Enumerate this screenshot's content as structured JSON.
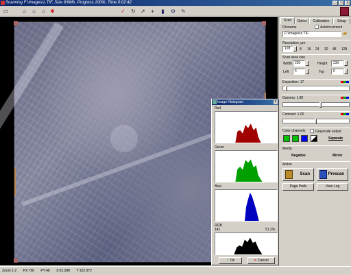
{
  "window": {
    "title": "Scanning F:\\Images\\z.TIF, Size 9/9Mb, Progress 100%, Time 0:02:42",
    "minimize": "_",
    "maximize": "□",
    "close": "x"
  },
  "toolbar": {
    "icons": [
      "open-icon",
      "home-icon",
      "prev-home-icon",
      "next-home-icon",
      "figure-icon",
      "check-icon",
      "rotate-icon",
      "pointer-icon",
      "crosshair-icon",
      "chart-icon",
      "gears-icon",
      "camera-icon",
      "book-icon"
    ],
    "glyphs": [
      "▭",
      "⌂",
      "⌂",
      "⌂",
      "✱",
      "✓",
      "↻",
      "➚",
      "+",
      "▮",
      "⚙",
      "✎"
    ]
  },
  "panel": {
    "tabs": [
      "Scan",
      "Optics",
      "Calibration",
      "Setup"
    ],
    "filename_label": "Filename",
    "autoincrement_label": "Autoincrement",
    "filename_value": "F:\\Images\\z.TIF",
    "resolution_label": "Resolution, µm",
    "resolution_value": "128",
    "resolution_options": [
      "8",
      "16",
      "24",
      "32",
      "48",
      "128"
    ],
    "scan_area_label": "Scan area size",
    "width_label": "Width",
    "width_value": "230",
    "height_label": "Height",
    "height_value": "230",
    "left_label": "Left",
    "left_value": "4",
    "top_label": "Top",
    "top_value": "0",
    "exposition_label": "Exposition: 17",
    "exposition_level": 0.03,
    "gamma_label": "Gamma: 1.80",
    "gamma_level": 0.58,
    "contrast_label": "Contrast: 1.00",
    "contrast_level": 0.5,
    "color_channels_label": "Color channels",
    "grayscale_label": "Grayscale output",
    "separate_label": "Separate",
    "media_label": "Media",
    "negative_label": "Negative",
    "mirror_label": "Mirror",
    "action_label": "Action",
    "scan_label": "Scan",
    "prescan_label": "Prescan",
    "page_prefs_label": "Page Prefs",
    "view_log_label": "View Log",
    "swatch_colors": [
      "#00c000",
      "#00c000",
      "#0000ff"
    ]
  },
  "histogram": {
    "title": "Image Histogram",
    "red_label": "Red",
    "green_label": "Green",
    "blue_label": "Blue",
    "rgb_label": "RGB",
    "rgb_value_left": "141",
    "rgb_value_right": "51.2%",
    "ok_label": "Ok",
    "cancel_label": "Cancel",
    "colors": {
      "red": "#a00000",
      "green": "#00a000",
      "blue": "#0000c0",
      "rgb": "#000000"
    }
  },
  "status": {
    "zoom": "Zoom 1:2",
    "px": "PX:798",
    "py": "PY:48",
    "x": "X:81.998",
    "y": "Y:102.972"
  }
}
